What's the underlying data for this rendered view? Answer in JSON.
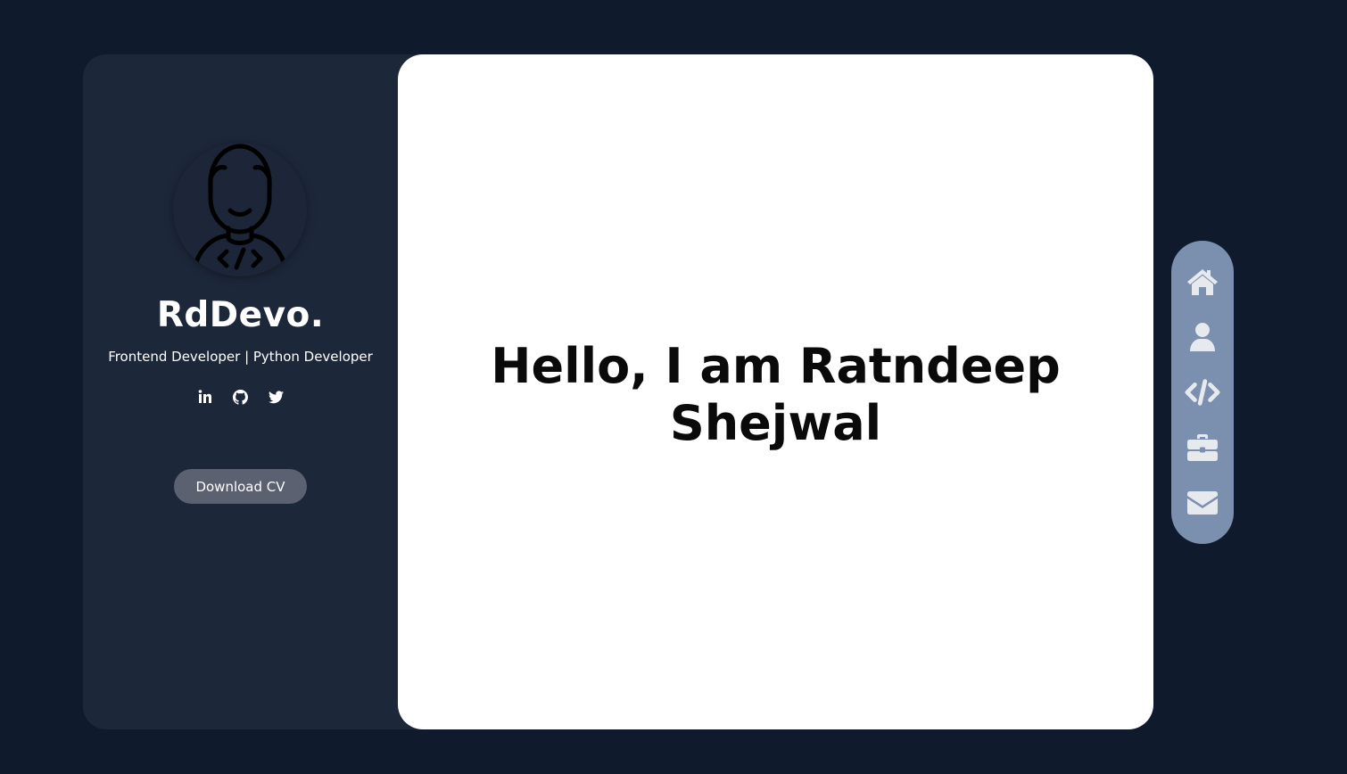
{
  "sidebar": {
    "brand": "RdDevo.",
    "role": "Frontend Developer | Python Developer",
    "socials": [
      {
        "icon": "linkedin-icon"
      },
      {
        "icon": "github-icon"
      },
      {
        "icon": "twitter-icon"
      }
    ],
    "cv_button": "Download CV"
  },
  "main": {
    "greeting": "Hello, I am Ratndeep Shejwal"
  },
  "nav": {
    "items": [
      {
        "icon": "home-icon"
      },
      {
        "icon": "user-icon"
      },
      {
        "icon": "code-icon"
      },
      {
        "icon": "briefcase-icon"
      },
      {
        "icon": "envelope-icon"
      }
    ]
  },
  "colors": {
    "background": "#0f1b2c",
    "sidebar": "#1d273a",
    "nav": "#7b8fae",
    "button": "#5b6170",
    "card": "#ffffff"
  }
}
